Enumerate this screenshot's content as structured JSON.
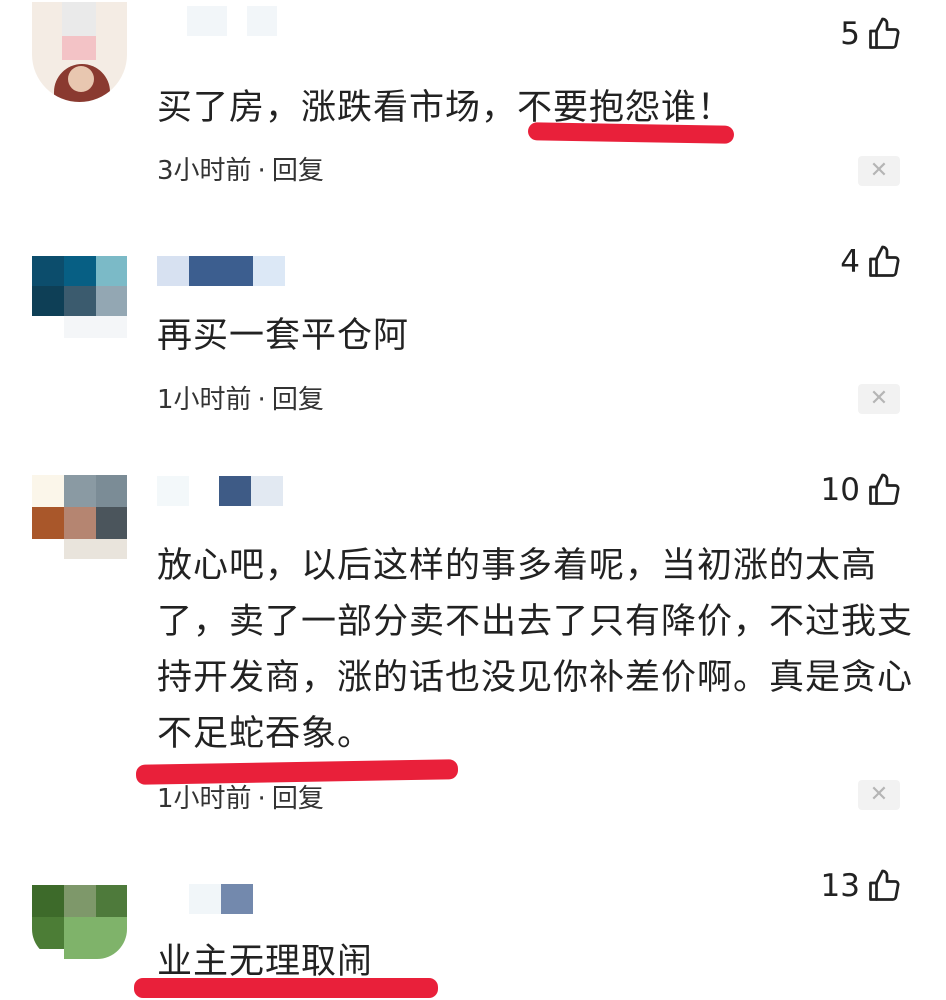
{
  "comments": [
    {
      "likes": "5",
      "text": "买了房，涨跌看市场，不要抱怨谁！",
      "time": "3小时前",
      "reply": "回复",
      "close": "✕"
    },
    {
      "likes": "4",
      "text": "再买一套平仓阿",
      "time": "1小时前",
      "reply": "回复",
      "close": "✕"
    },
    {
      "likes": "10",
      "text": "放心吧，以后这样的事多着呢，当初涨的太高了，卖了一部分卖不出去了只有降价，不过我支持开发商，涨的话也没见你补差价啊。真是贪心不足蛇吞象。",
      "time": "1小时前",
      "reply": "回复",
      "close": "✕"
    },
    {
      "likes": "13",
      "text": "业主无理取闹"
    }
  ],
  "meta_separator": "·",
  "colors": {
    "highlight": "#e9203a",
    "text": "#222222",
    "muted": "#b5b5b5"
  },
  "icons": {
    "like": "thumbs-up-icon",
    "close": "close-icon"
  }
}
